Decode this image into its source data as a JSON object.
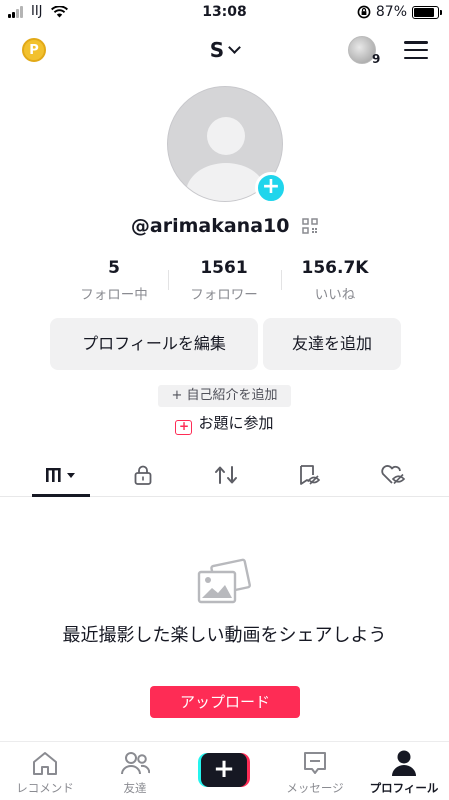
{
  "status_bar": {
    "carrier": "IIJ",
    "time": "13:08",
    "battery_percent": "87%",
    "battery_level": 0.87
  },
  "header": {
    "account_name": "S",
    "story_count": "9"
  },
  "profile": {
    "username": "@arimakana10",
    "stats": [
      {
        "value": "5",
        "label": "フォロー中"
      },
      {
        "value": "1561",
        "label": "フォロワー"
      },
      {
        "value": "156.7K",
        "label": "いいね"
      }
    ],
    "edit_profile_label": "プロフィールを編集",
    "add_friend_label": "友達を追加",
    "add_bio_label": "+ 自己紹介を追加",
    "challenge_label": "お題に参加"
  },
  "tabs": [
    "videos-grid",
    "private",
    "reposts",
    "favorites",
    "liked"
  ],
  "empty_state": {
    "message": "最近撮影した楽しい動画をシェアしよう",
    "upload_label": "アップロード"
  },
  "bottom_nav": [
    {
      "label": "レコメンド",
      "icon": "home-icon"
    },
    {
      "label": "友達",
      "icon": "friends-icon"
    },
    {
      "label": "",
      "icon": "create-icon"
    },
    {
      "label": "メッセージ",
      "icon": "inbox-icon"
    },
    {
      "label": "プロフィール",
      "icon": "profile-icon",
      "active": true
    }
  ],
  "colors": {
    "accent": "#fe2c55",
    "cyan": "#25f4ee",
    "add_avatar": "#20d5ec",
    "text": "#161823",
    "muted": "#8a8b91"
  }
}
